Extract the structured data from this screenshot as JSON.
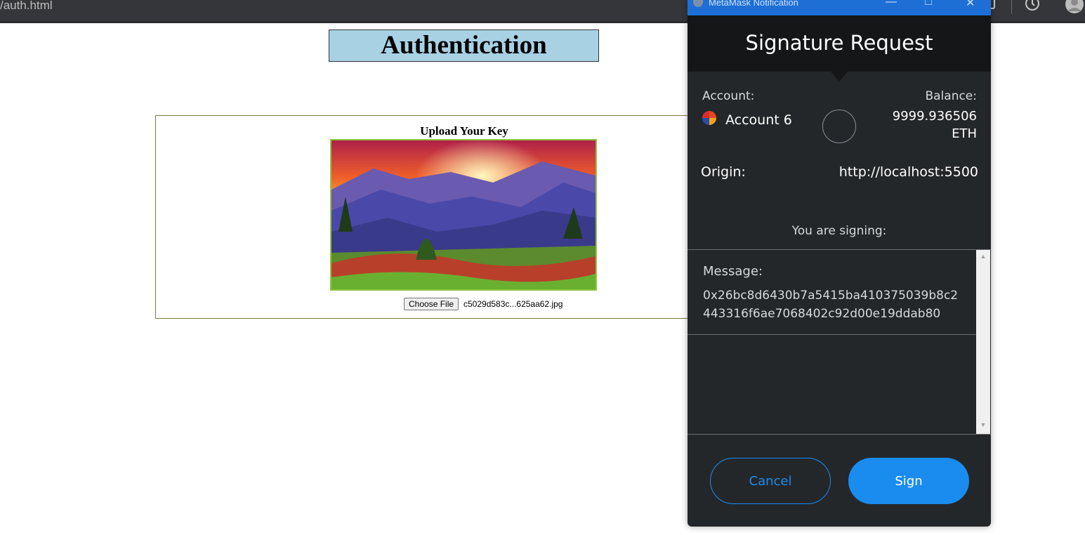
{
  "browser": {
    "url": "/auth.html",
    "history_icon": "history-icon",
    "profile_icon": "profile-icon"
  },
  "page": {
    "title": "Authentication",
    "upload_heading": "Upload Your Key",
    "choose_file_label": "Choose File",
    "file_name": "c5029d583c...625aa62.jpg"
  },
  "metamask": {
    "window_title": "MetaMask Notification",
    "header_title": "Signature Request",
    "account_label": "Account:",
    "account_name": "Account 6",
    "balance_label": "Balance:",
    "balance_amount": "9999.936506",
    "balance_unit": "ETH",
    "origin_label": "Origin:",
    "origin_value": "http://localhost:5500",
    "signing_label": "You are signing:",
    "message_label": "Message:",
    "message_value": "0x26bc8d6430b7a5415ba410375039b8c2443316f6ae7068402c92d00e19ddab80",
    "cancel_label": "Cancel",
    "sign_label": "Sign",
    "colors": {
      "accent": "#1a8cf0",
      "background": "#24272a",
      "header": "#141618",
      "titlebar": "#1d6fd6"
    }
  }
}
